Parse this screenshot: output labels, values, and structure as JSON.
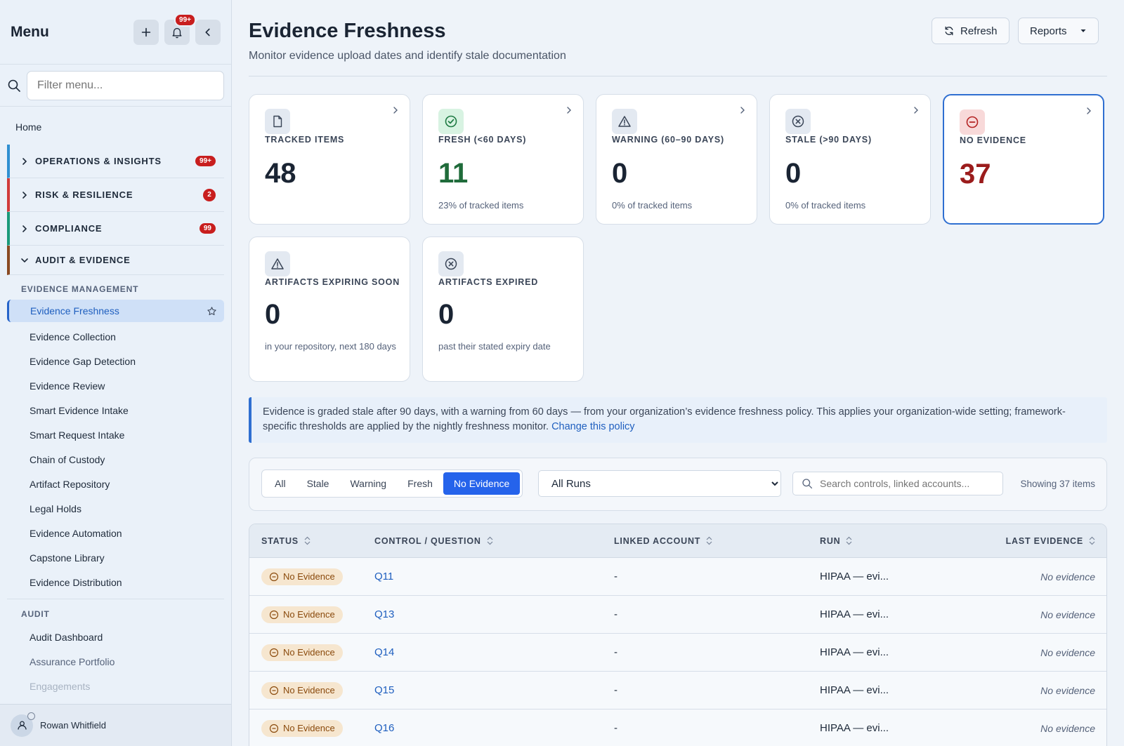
{
  "sidebar": {
    "title": "Menu",
    "bell_badge": "99+",
    "filter_placeholder": "Filter menu...",
    "home": "Home",
    "groups": [
      {
        "label": "OPERATIONS & INSIGHTS",
        "badge": "99+",
        "color": "#2f8fd1"
      },
      {
        "label": "RISK & RESILIENCE",
        "badge": "2",
        "color": "#d13b3b"
      },
      {
        "label": "COMPLIANCE",
        "badge": "99",
        "color": "#1a9a7a"
      },
      {
        "label": "AUDIT & EVIDENCE",
        "badge": "",
        "color": "#8a4a22"
      }
    ],
    "sections": {
      "evidence_mgmt": "EVIDENCE MANAGEMENT",
      "audit": "AUDIT"
    },
    "evidence_items": [
      "Evidence Freshness",
      "Evidence Collection",
      "Evidence Gap Detection",
      "Evidence Review",
      "Smart Evidence Intake",
      "Smart Request Intake",
      "Chain of Custody",
      "Artifact Repository",
      "Legal Holds",
      "Evidence Automation",
      "Capstone Library",
      "Evidence Distribution"
    ],
    "audit_items": [
      "Audit Dashboard",
      "Assurance Portfolio",
      "Engagements"
    ],
    "user": "Rowan Whitfield"
  },
  "header": {
    "title": "Evidence Freshness",
    "subtitle": "Monitor evidence upload dates and identify stale documentation",
    "refresh": "Refresh",
    "reports": "Reports"
  },
  "cards": [
    {
      "label": "TRACKED ITEMS",
      "value": "48",
      "sub": "",
      "icon": "document-icon"
    },
    {
      "label": "FRESH (<60 DAYS)",
      "value": "11",
      "sub": "23% of tracked items",
      "icon": "check-circle-icon"
    },
    {
      "label": "WARNING (60–90 DAYS)",
      "value": "0",
      "sub": "0% of tracked items",
      "icon": "warning-icon"
    },
    {
      "label": "STALE (>90 DAYS)",
      "value": "0",
      "sub": "0% of tracked items",
      "icon": "x-circle-icon"
    },
    {
      "label": "NO EVIDENCE",
      "value": "37",
      "sub": "",
      "icon": "minus-circle-icon"
    },
    {
      "label": "ARTIFACTS EXPIRING SOON",
      "value": "0",
      "sub": "in your repository, next 180 days",
      "icon": "warning-icon"
    },
    {
      "label": "ARTIFACTS EXPIRED",
      "value": "0",
      "sub": "past their stated expiry date",
      "icon": "x-circle-icon"
    }
  ],
  "notice": {
    "text": "Evidence is graded stale after 90 days, with a warning from 60 days — from your organization’s evidence freshness policy. This applies your organization-wide setting; framework-specific thresholds are applied by the nightly freshness monitor.",
    "link": "Change this policy"
  },
  "filters": {
    "tabs": [
      "All",
      "Stale",
      "Warning",
      "Fresh",
      "No Evidence"
    ],
    "active_tab": "No Evidence",
    "run_selected": "All Runs",
    "search_placeholder": "Search controls, linked accounts...",
    "showing": "Showing 37 items"
  },
  "table": {
    "headers": [
      "STATUS",
      "CONTROL / QUESTION",
      "LINKED ACCOUNT",
      "RUN",
      "LAST EVIDENCE"
    ],
    "rows": [
      {
        "status": "No Evidence",
        "control": "Q11",
        "account": "-",
        "run": "HIPAA — evi...",
        "last": "No evidence"
      },
      {
        "status": "No Evidence",
        "control": "Q13",
        "account": "-",
        "run": "HIPAA — evi...",
        "last": "No evidence"
      },
      {
        "status": "No Evidence",
        "control": "Q14",
        "account": "-",
        "run": "HIPAA — evi...",
        "last": "No evidence"
      },
      {
        "status": "No Evidence",
        "control": "Q15",
        "account": "-",
        "run": "HIPAA — evi...",
        "last": "No evidence"
      },
      {
        "status": "No Evidence",
        "control": "Q16",
        "account": "-",
        "run": "HIPAA — evi...",
        "last": "No evidence"
      }
    ]
  },
  "colors": {
    "accent": "#2563eb",
    "fresh": "#1f6b3a",
    "no_evidence": "#9b1c1c",
    "badge": "#c81e1e"
  }
}
